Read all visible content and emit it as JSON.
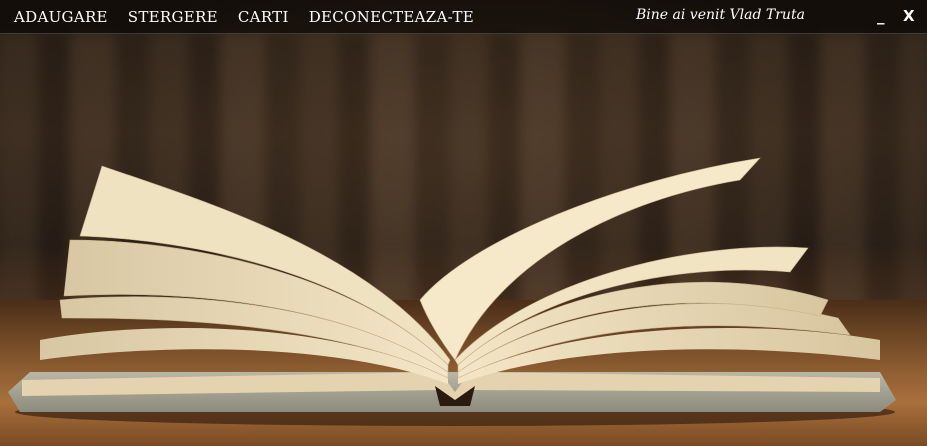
{
  "menu": {
    "items": [
      {
        "label": "ADAUGARE"
      },
      {
        "label": "STERGERE"
      },
      {
        "label": "CARTI"
      },
      {
        "label": "DECONECTEAZA-TE"
      }
    ]
  },
  "header": {
    "welcome_text": "Bine ai venit Vlad Truta"
  },
  "window_controls": {
    "minimize_label": "_",
    "close_label": "X"
  },
  "background": {
    "image": "open-book-on-wooden-table"
  }
}
